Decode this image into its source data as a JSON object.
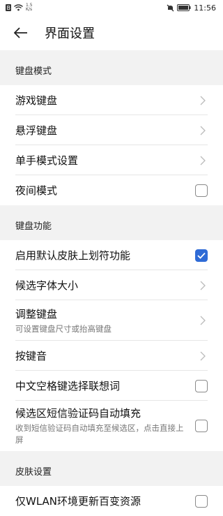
{
  "status": {
    "speed_value": "1.5",
    "speed_unit": "K/s",
    "time": "11:56"
  },
  "appbar": {
    "title": "界面设置"
  },
  "sections": {
    "keyboard_mode": {
      "header": "键盘模式",
      "items": [
        {
          "label": "游戏键盘"
        },
        {
          "label": "悬浮键盘"
        },
        {
          "label": "单手模式设置"
        },
        {
          "label": "夜间模式",
          "checked": false
        }
      ]
    },
    "keyboard_function": {
      "header": "键盘功能",
      "items": [
        {
          "label": "启用默认皮肤上划符功能",
          "checked": true
        },
        {
          "label": "候选字体大小"
        },
        {
          "label": "调整键盘",
          "sub": "可设置键盘尺寸或抬高键盘"
        },
        {
          "label": "按键音"
        },
        {
          "label": "中文空格键选择联想词",
          "checked": false
        },
        {
          "label": "候选区短信验证码自动填充",
          "sub": "收到短信验证码自动填充至候选区，点击直接上屏",
          "checked": false
        }
      ]
    },
    "skin": {
      "header": "皮肤设置",
      "items": [
        {
          "label": "仅WLAN环境更新百变资源",
          "checked": false
        }
      ]
    }
  },
  "colors": {
    "accent": "#2f6bd6",
    "section_bg": "#f2f2f2"
  }
}
